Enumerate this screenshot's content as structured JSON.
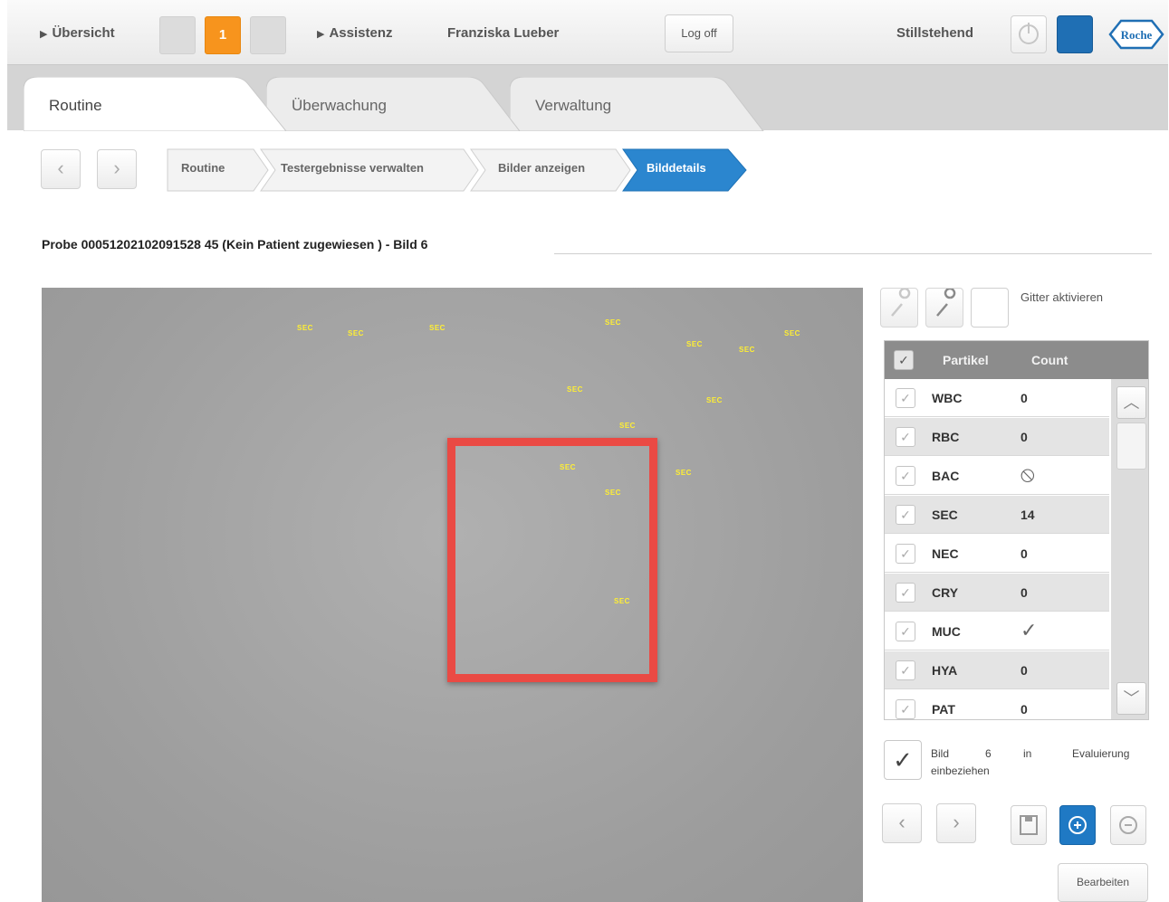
{
  "topbar": {
    "overview_label": "Übersicht",
    "notification_count": "1",
    "assistance_label": "Assistenz",
    "user_name": "Franziska Lueber",
    "logoff_label": "Log off",
    "status_text": "Stillstehend",
    "brand_logo": "Roche"
  },
  "tabs": [
    {
      "label": "Routine",
      "active": true
    },
    {
      "label": "Überwachung",
      "active": false
    },
    {
      "label": "Verwaltung",
      "active": false
    }
  ],
  "breadcrumb": [
    {
      "label": "Routine",
      "active": false
    },
    {
      "label": "Testergebnisse verwalten",
      "active": false
    },
    {
      "label": "Bilder anzeigen",
      "active": false
    },
    {
      "label": "Bilddetails",
      "active": true
    }
  ],
  "sample": {
    "title": "Probe 00051202102091528 45  (Kein Patient zugewiesen ) - Bild 6"
  },
  "image": {
    "particle_tag_label": "SEC",
    "selection_color": "#ea4a44"
  },
  "panel": {
    "grid_label": "Gitter aktivieren",
    "table_headers": {
      "particle": "Partikel",
      "count": "Count"
    },
    "rows": [
      {
        "name": "WBC",
        "count": "0"
      },
      {
        "name": "RBC",
        "count": "0"
      },
      {
        "name": "BAC",
        "count": "",
        "symbol": "prohibited-icon"
      },
      {
        "name": "SEC",
        "count": "14"
      },
      {
        "name": "NEC",
        "count": "0"
      },
      {
        "name": "CRY",
        "count": "0"
      },
      {
        "name": "MUC",
        "count": "",
        "symbol": "checkmark-icon"
      },
      {
        "name": "HYA",
        "count": "0"
      },
      {
        "name": "PAT",
        "count": "0"
      }
    ],
    "eval_words": [
      "Bild",
      "6",
      "in",
      "Evaluierung"
    ],
    "eval_sub": "einbeziehen",
    "edit_label": "Bearbeiten"
  },
  "colors": {
    "accent_blue": "#1f79c4",
    "notification_orange": "#f7941d"
  }
}
